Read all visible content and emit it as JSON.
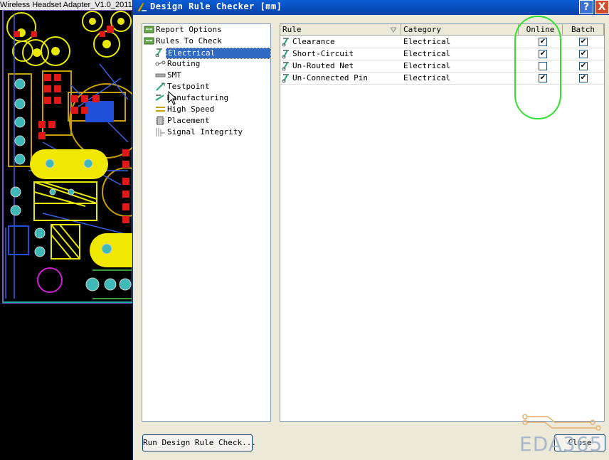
{
  "pcb": {
    "window_title": "Wireless Headset Adapter_V1.0_20111"
  },
  "dialog": {
    "title": "Design Rule Checker [mm]",
    "help_glyph": "?",
    "close_glyph": "X",
    "tree": [
      {
        "label": "Report Options",
        "icon": "report-options-icon",
        "indent": 0,
        "selected": false
      },
      {
        "label": "Rules To Check",
        "icon": "rules-to-check-icon",
        "indent": 0,
        "selected": false
      },
      {
        "label": "Electrical",
        "icon": "electrical-icon",
        "indent": 1,
        "selected": true
      },
      {
        "label": "Routing",
        "icon": "routing-icon",
        "indent": 1,
        "selected": false
      },
      {
        "label": "SMT",
        "icon": "smt-icon",
        "indent": 1,
        "selected": false
      },
      {
        "label": "Testpoint",
        "icon": "testpoint-icon",
        "indent": 1,
        "selected": false
      },
      {
        "label": "Manufacturing",
        "icon": "manufacturing-icon",
        "indent": 1,
        "selected": false
      },
      {
        "label": "High Speed",
        "icon": "high-speed-icon",
        "indent": 1,
        "selected": false
      },
      {
        "label": "Placement",
        "icon": "placement-icon",
        "indent": 1,
        "selected": false
      },
      {
        "label": "Signal Integrity",
        "icon": "signal-integrity-icon",
        "indent": 1,
        "selected": false
      }
    ],
    "table": {
      "columns": {
        "rule": "Rule",
        "category": "Category",
        "online": "Online",
        "batch": "Batch"
      },
      "rows": [
        {
          "rule": "Clearance",
          "category": "Electrical",
          "online": true,
          "batch": true
        },
        {
          "rule": "Short-Circuit",
          "category": "Electrical",
          "online": true,
          "batch": true
        },
        {
          "rule": "Un-Routed Net",
          "category": "Electrical",
          "online": false,
          "batch": true
        },
        {
          "rule": "Un-Connected Pin",
          "category": "Electrical",
          "online": true,
          "batch": true
        }
      ]
    },
    "buttons": {
      "run": "Run Design Rule Check...",
      "close": "Close"
    },
    "watermark": "EDA365"
  },
  "colors": {
    "title_bar": "#0a5ed7",
    "selection": "#316ac5",
    "annotation": "#2fe02f",
    "pcb_background": "#000000"
  }
}
